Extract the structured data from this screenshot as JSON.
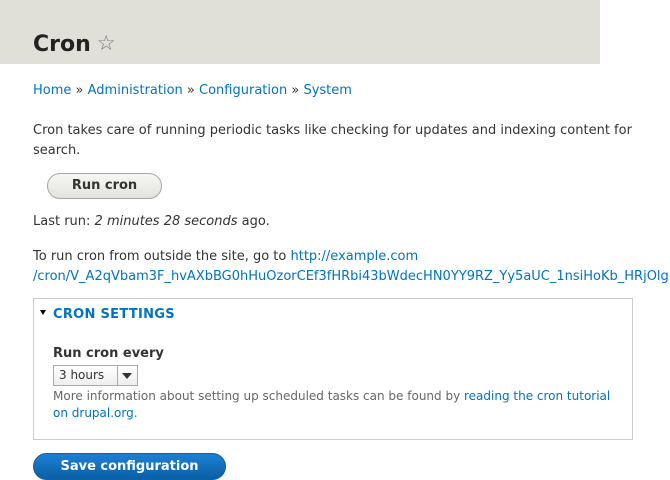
{
  "header": {
    "title": "Cron",
    "favorite_icon": "star-outline-icon"
  },
  "breadcrumb": {
    "items": [
      "Home",
      "Administration",
      "Configuration",
      "System"
    ],
    "separator": "»"
  },
  "description": "Cron takes care of running periodic tasks like checking for updates and indexing content for search.",
  "run_button_label": "Run cron",
  "last_run": {
    "prefix": "Last run: ",
    "value": "2 minutes 28 seconds",
    "suffix": " ago."
  },
  "outside": {
    "text": "To run cron from outside the site, go to ",
    "url_line1": "http://example.com",
    "url_line2": "/cron/V_A2qVbam3F_hvAXbBG0hHuOzorCEf3fHRbi43bWdecHN0YY9RZ_Yy5aUC_1nsiHoKb_HRjOlg"
  },
  "cron_settings": {
    "legend": "CRON SETTINGS",
    "field_label": "Run cron every",
    "selected_option": "3 hours",
    "help_text": "More information about setting up scheduled tasks can be found by ",
    "help_link": "reading the cron tutorial on drupal.org",
    "help_end": "."
  },
  "save_button_label": "Save configuration",
  "colors": {
    "link": "#0074bd",
    "header_bg": "#e0e0d8",
    "primary_button": "#0a6ebd"
  }
}
